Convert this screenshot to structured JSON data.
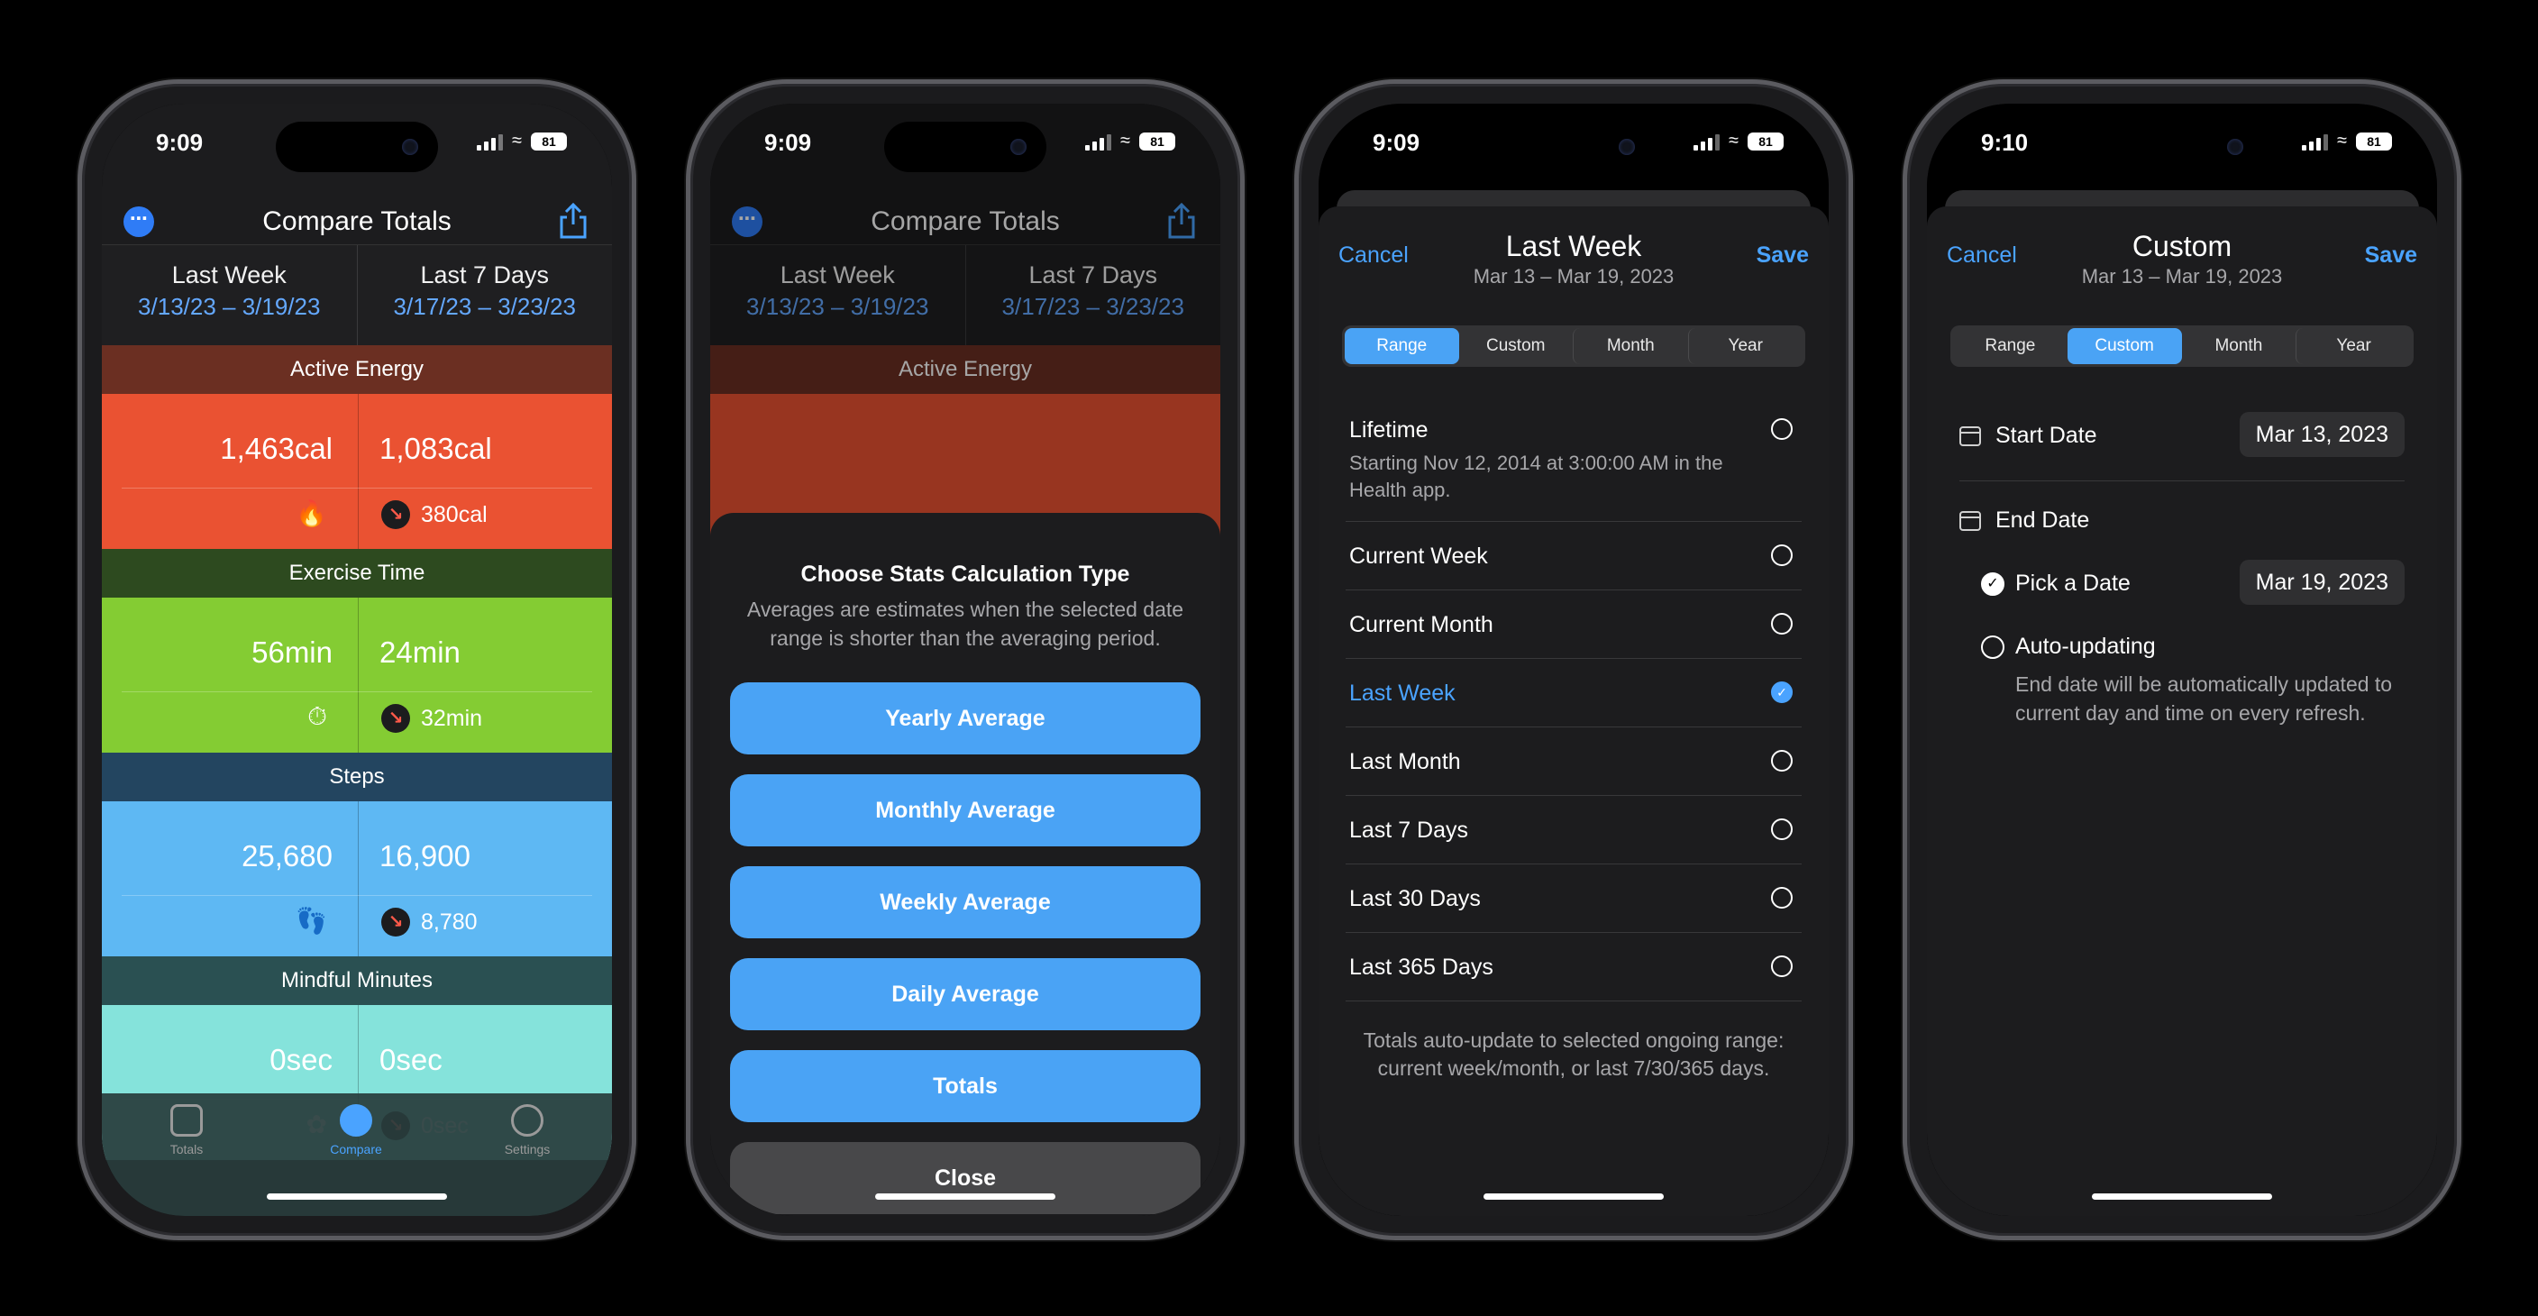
{
  "status_bar": [
    {
      "time": "9:09",
      "battery": "81"
    },
    {
      "time": "9:09",
      "battery": "81"
    },
    {
      "time": "9:09",
      "battery": "81"
    },
    {
      "time": "9:10",
      "battery": "81"
    }
  ],
  "compare": {
    "title": "Compare Totals",
    "left": {
      "label": "Last Week",
      "range": "3/13/23 – 3/19/23"
    },
    "right": {
      "label": "Last 7 Days",
      "range": "3/17/23 – 3/23/23"
    },
    "metrics": [
      {
        "name": "Active Energy",
        "left": "1,463cal",
        "right": "1,083cal",
        "diff": "380cal",
        "icon": "flame-icon",
        "header_color": "#6b2f22",
        "color": "#ea5232"
      },
      {
        "name": "Exercise Time",
        "left": "56min",
        "right": "24min",
        "diff": "32min",
        "icon": "timer-icon",
        "header_color": "#2d4a1f",
        "color": "#84cc33"
      },
      {
        "name": "Steps",
        "left": "25,680",
        "right": "16,900",
        "diff": "8,780",
        "icon": "footprints-icon",
        "header_color": "#234560",
        "color": "#5eb8f3"
      },
      {
        "name": "Mindful Minutes",
        "left": "0sec",
        "right": "0sec",
        "diff": "0sec",
        "icon": "mindful-icon",
        "header_color": "#2a5052",
        "color": "#85e3db"
      }
    ],
    "tabs": [
      {
        "label": "Totals",
        "active": false
      },
      {
        "label": "Compare",
        "active": true
      },
      {
        "label": "Settings",
        "active": false
      }
    ]
  },
  "stats_sheet": {
    "title": "Choose Stats Calculation Type",
    "subtitle": "Averages are estimates when the selected date range is shorter than the averaging period.",
    "options": [
      "Yearly Average",
      "Monthly Average",
      "Weekly Average",
      "Daily Average",
      "Totals"
    ],
    "close": "Close"
  },
  "range_modal": {
    "cancel": "Cancel",
    "save": "Save",
    "title": "Last Week",
    "subtitle": "Mar 13 – Mar 19, 2023",
    "segments": [
      "Range",
      "Custom",
      "Month",
      "Year"
    ],
    "selected_segment": "Range",
    "lifetime": {
      "label": "Lifetime",
      "desc": "Starting Nov 12, 2014 at 3:00:00 AM in the Health app."
    },
    "options": [
      {
        "label": "Current Week",
        "selected": false
      },
      {
        "label": "Current Month",
        "selected": false
      },
      {
        "label": "Last Week",
        "selected": true
      },
      {
        "label": "Last Month",
        "selected": false
      },
      {
        "label": "Last 7 Days",
        "selected": false
      },
      {
        "label": "Last 30 Days",
        "selected": false
      },
      {
        "label": "Last 365 Days",
        "selected": false
      }
    ],
    "footer": "Totals auto-update to selected ongoing range: current week/month, or last 7/30/365 days."
  },
  "custom_modal": {
    "cancel": "Cancel",
    "save": "Save",
    "title": "Custom",
    "subtitle": "Mar 13 – Mar 19, 2023",
    "segments": [
      "Range",
      "Custom",
      "Month",
      "Year"
    ],
    "selected_segment": "Custom",
    "start_label": "Start Date",
    "start_value": "Mar 13, 2023",
    "end_label": "End Date",
    "pick_label": "Pick a Date",
    "pick_value": "Mar 19, 2023",
    "auto_label": "Auto-updating",
    "auto_desc": "End date will be automatically updated to current day and time on every refresh."
  }
}
